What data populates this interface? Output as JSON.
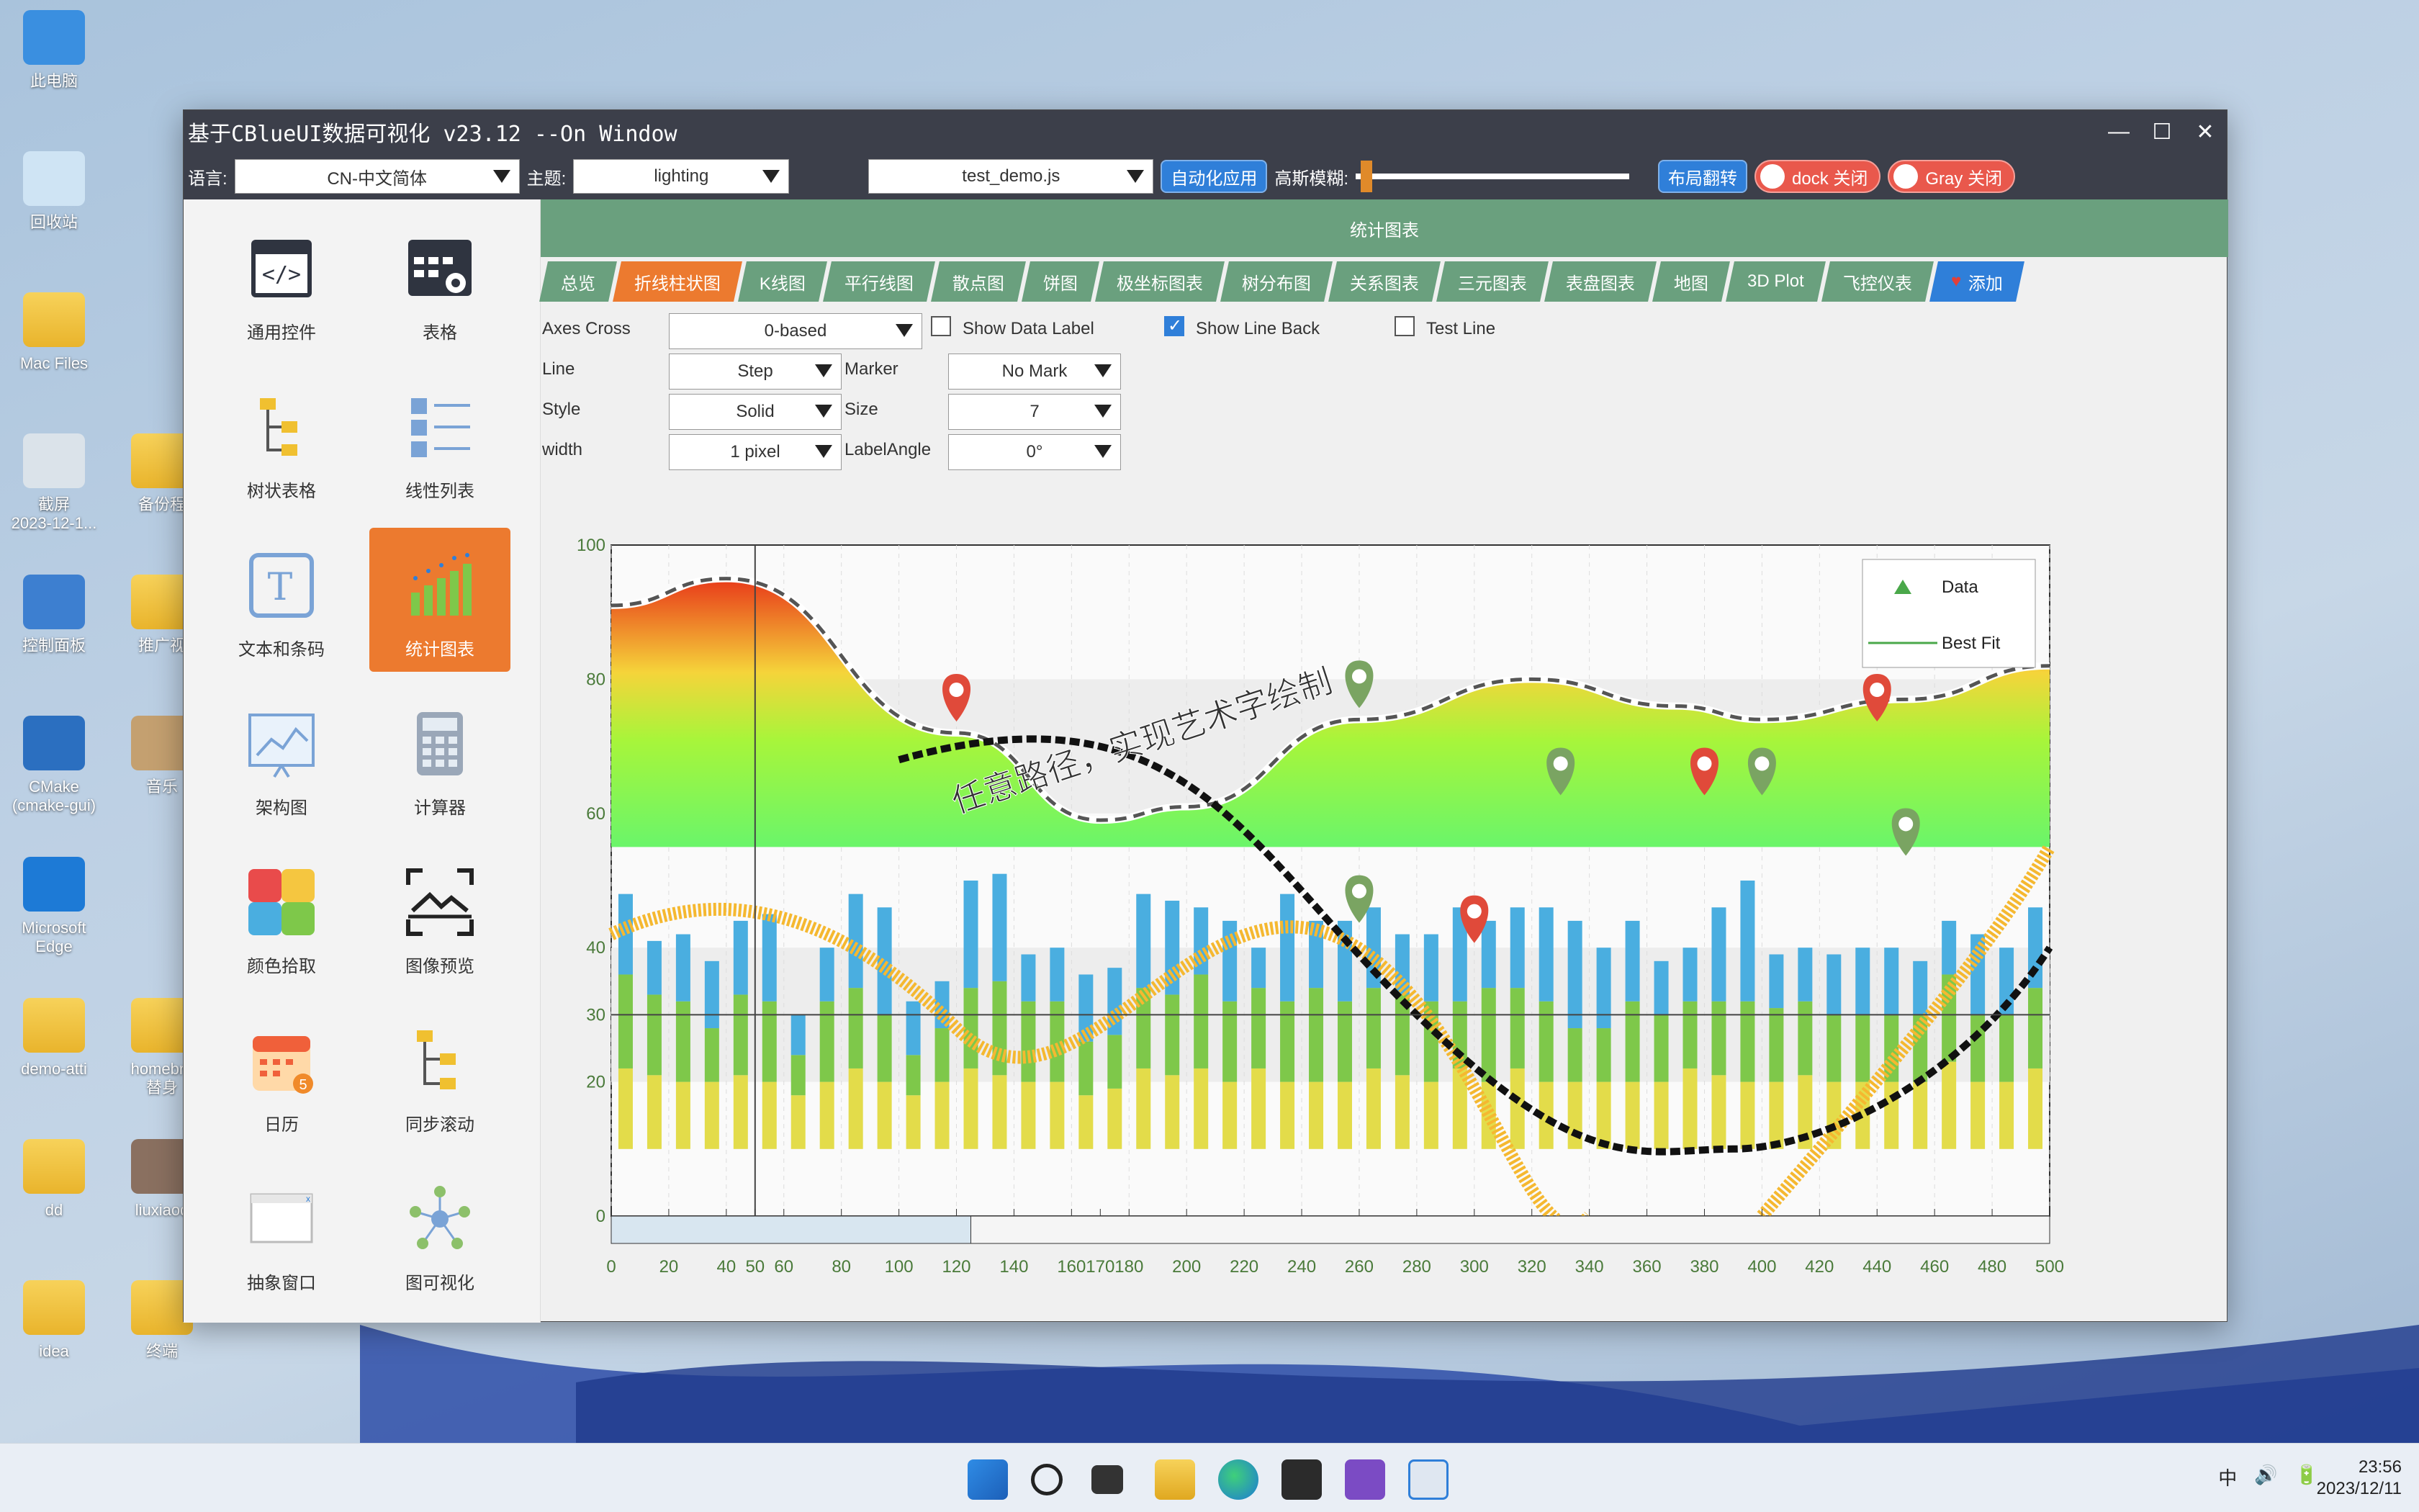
{
  "desktop": {
    "icons": [
      {
        "label": "此电脑"
      },
      {
        "label": "回收站"
      },
      {
        "label": "Mac Files"
      },
      {
        "label": "截屏\n2023-12-1..."
      },
      {
        "label": "备份程"
      },
      {
        "label": "控制面板"
      },
      {
        "label": "推广视"
      },
      {
        "label": "CMake\n(cmake-gui)"
      },
      {
        "label": "音乐"
      },
      {
        "label": "Microsoft\nEdge"
      },
      {
        "label": "demo-atti"
      },
      {
        "label": "homebre\n替身"
      },
      {
        "label": "dd"
      },
      {
        "label": "liuxiaod"
      },
      {
        "label": "idea"
      },
      {
        "label": "终端"
      }
    ]
  },
  "window": {
    "title": "基于CBlueUI数据可视化 v23.12 --On Window",
    "controls": [
      "—",
      "☐",
      "✕"
    ]
  },
  "toolbar": {
    "language_label": "语言:",
    "language_value": "CN-中文简体",
    "theme_label": "主题:",
    "theme_value": "lighting",
    "script_value": "test_demo.js",
    "auto_apply": "自动化应用",
    "blur_label": "高斯模糊:",
    "blur_level": 0.02,
    "layout_flip": "布局翻转",
    "dock_toggle": "dock 关闭",
    "gray_toggle": "Gray 关闭"
  },
  "sidebar": {
    "items": [
      {
        "label": "通用控件",
        "icon": "code-window-icon"
      },
      {
        "label": "表格",
        "icon": "table-gear-icon"
      },
      {
        "label": "树状表格",
        "icon": "tree-table-icon"
      },
      {
        "label": "线性列表",
        "icon": "list-icon"
      },
      {
        "label": "文本和条码",
        "icon": "text-icon"
      },
      {
        "label": "统计图表",
        "icon": "bar-chart-icon",
        "active": true
      },
      {
        "label": "架构图",
        "icon": "architecture-icon"
      },
      {
        "label": "计算器",
        "icon": "calculator-icon"
      },
      {
        "label": "颜色拾取",
        "icon": "color-picker-icon"
      },
      {
        "label": "图像预览",
        "icon": "image-preview-icon"
      },
      {
        "label": "日历",
        "icon": "calendar-icon"
      },
      {
        "label": "同步滚动",
        "icon": "sync-scroll-icon"
      },
      {
        "label": "抽象窗口",
        "icon": "abstract-window-icon"
      },
      {
        "label": "图可视化",
        "icon": "graph-icon"
      }
    ]
  },
  "main": {
    "section_title": "统计图表",
    "tabs": [
      {
        "label": "总览"
      },
      {
        "label": "折线柱状图",
        "active": true
      },
      {
        "label": "K线图"
      },
      {
        "label": "平行线图"
      },
      {
        "label": "散点图"
      },
      {
        "label": "饼图"
      },
      {
        "label": "极坐标图表"
      },
      {
        "label": "树分布图"
      },
      {
        "label": "关系图表"
      },
      {
        "label": "三元图表"
      },
      {
        "label": "表盘图表"
      },
      {
        "label": "地图"
      },
      {
        "label": "3D Plot"
      },
      {
        "label": "飞控仪表"
      },
      {
        "label": "添加"
      }
    ],
    "options": {
      "axes_cross_label": "Axes Cross",
      "axes_cross_value": "0-based",
      "show_data_label": "Show Data Label",
      "show_data_label_checked": false,
      "show_line_back": "Show Line Back",
      "show_line_back_checked": true,
      "test_line": "Test Line",
      "test_line_checked": false,
      "line_label": "Line",
      "line_value": "Step",
      "marker_label": "Marker",
      "marker_value": "No Mark",
      "style_label": "Style",
      "style_value": "Solid",
      "size_label": "Size",
      "size_value": "7",
      "width_label": "width",
      "width_value": "1 pixel",
      "labelangle_label": "LabelAngle",
      "labelangle_value": "0°"
    }
  },
  "chart_data": {
    "type": "bar",
    "title": "",
    "art_text": "任意路径，实现艺术字绘制",
    "legend": [
      {
        "name": "Data",
        "marker": "triangle",
        "color": "#4aa84a"
      },
      {
        "name": "Best Fit",
        "marker": "line",
        "color": "#4aa84a"
      }
    ],
    "legend_position": "top-right",
    "xlim": [
      0,
      500
    ],
    "ylim": [
      0,
      100
    ],
    "x_ticks": [
      0,
      20,
      40,
      50,
      60,
      80,
      100,
      120,
      140,
      160,
      170,
      180,
      200,
      220,
      240,
      260,
      280,
      300,
      320,
      340,
      360,
      380,
      400,
      420,
      440,
      460,
      480,
      500
    ],
    "y_ticks": [
      0,
      20,
      30,
      40,
      60,
      80,
      100
    ],
    "vertical_line_x": 50,
    "horizontal_line_y": 30,
    "bars_x": [
      5,
      15,
      25,
      35,
      45,
      55,
      65,
      75,
      85,
      95,
      105,
      115,
      125,
      135,
      145,
      155,
      165,
      175,
      185,
      195,
      205,
      215,
      225,
      235,
      245,
      255,
      265,
      275,
      285,
      295,
      305,
      315,
      325,
      335,
      345,
      355,
      365,
      375,
      385,
      395,
      405,
      415,
      425,
      435,
      445,
      455,
      465,
      475,
      485,
      495
    ],
    "series": [
      {
        "name": "yellow",
        "color": "#e3dc4a",
        "values": [
          12,
          11,
          10,
          10,
          11,
          10,
          8,
          10,
          12,
          10,
          8,
          10,
          12,
          11,
          10,
          10,
          8,
          9,
          12,
          11,
          12,
          10,
          12,
          10,
          10,
          10,
          12,
          11,
          10,
          12,
          10,
          12,
          10,
          10,
          10,
          10,
          10,
          12,
          11,
          10,
          10,
          11,
          10,
          10,
          10,
          10,
          13,
          10,
          10,
          12
        ]
      },
      {
        "name": "green",
        "color": "#7ec84a",
        "values": [
          14,
          12,
          12,
          8,
          12,
          12,
          6,
          12,
          12,
          10,
          6,
          8,
          12,
          14,
          12,
          12,
          8,
          8,
          12,
          12,
          14,
          12,
          12,
          12,
          14,
          12,
          12,
          12,
          12,
          10,
          14,
          12,
          12,
          8,
          8,
          12,
          10,
          10,
          11,
          12,
          11,
          11,
          10,
          10,
          10,
          10,
          13,
          10,
          10,
          12
        ]
      },
      {
        "name": "blue",
        "color": "#4aaee0",
        "values": [
          12,
          8,
          10,
          10,
          11,
          13,
          6,
          8,
          14,
          16,
          8,
          7,
          16,
          16,
          7,
          8,
          10,
          10,
          14,
          14,
          10,
          12,
          6,
          16,
          10,
          12,
          12,
          9,
          10,
          14,
          10,
          12,
          14,
          16,
          12,
          12,
          8,
          8,
          14,
          18,
          8,
          8,
          9,
          10,
          10,
          8,
          8,
          12,
          10,
          12
        ]
      }
    ],
    "line_series": [
      {
        "name": "Best Fit",
        "color": "#f26a2a",
        "points": [
          [
            0,
            91
          ],
          [
            40,
            95
          ],
          [
            120,
            72
          ],
          [
            170,
            59
          ],
          [
            200,
            61
          ],
          [
            260,
            74
          ],
          [
            320,
            80
          ],
          [
            370,
            76
          ],
          [
            400,
            74
          ],
          [
            450,
            77
          ],
          [
            500,
            82
          ]
        ]
      }
    ],
    "markers": [
      {
        "x": 120,
        "y": 78,
        "color": "#e04a3a"
      },
      {
        "x": 260,
        "y": 80,
        "color": "#7aa462"
      },
      {
        "x": 330,
        "y": 67,
        "color": "#7aa462"
      },
      {
        "x": 380,
        "y": 67,
        "color": "#e04a3a"
      },
      {
        "x": 400,
        "y": 67,
        "color": "#7aa462"
      },
      {
        "x": 440,
        "y": 78,
        "color": "#e04a3a"
      },
      {
        "x": 450,
        "y": 58,
        "color": "#7aa462"
      },
      {
        "x": 260,
        "y": 48,
        "color": "#7aa462"
      },
      {
        "x": 300,
        "y": 45,
        "color": "#e04a3a"
      }
    ]
  },
  "taskbar": {
    "tray": [
      "中",
      "🔊",
      "🔋"
    ],
    "time": "23:56",
    "date": "2023/12/11"
  }
}
